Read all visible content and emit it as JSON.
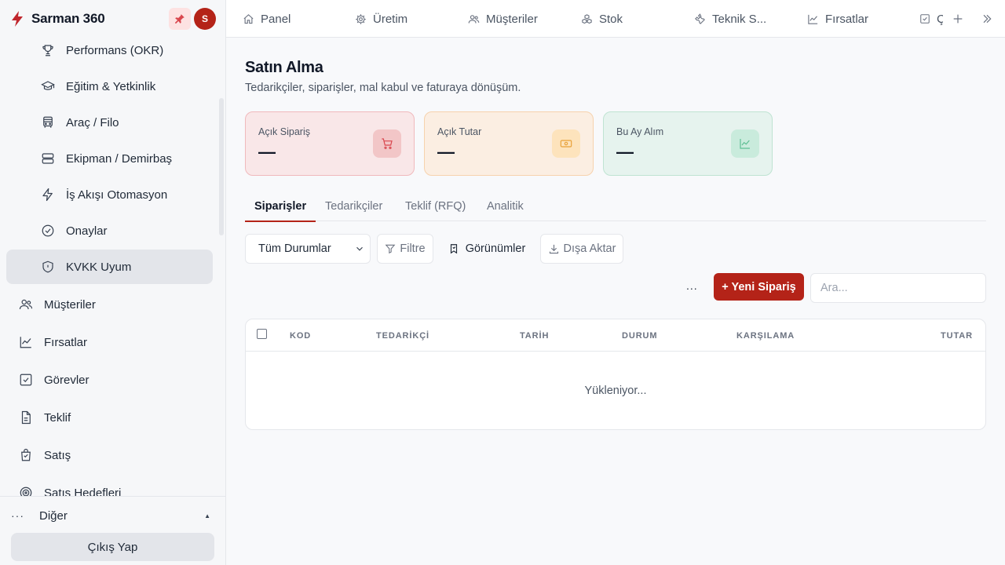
{
  "brand": {
    "name": "Sarman 360",
    "avatar_initial": "S",
    "accent": "#b42318"
  },
  "sidebar": {
    "sub_items": [
      {
        "label": "Performans (OKR)",
        "icon": "trophy-icon"
      },
      {
        "label": "Eğitim & Yetkinlik",
        "icon": "graduation-cap-icon"
      },
      {
        "label": "Araç / Filo",
        "icon": "bus-icon"
      },
      {
        "label": "Ekipman / Demirbaş",
        "icon": "server-icon"
      },
      {
        "label": "İş Akışı Otomasyon",
        "icon": "lightning-icon"
      },
      {
        "label": "Onaylar",
        "icon": "check-circle-icon"
      },
      {
        "label": "KVKK Uyum",
        "icon": "shield-icon",
        "active": true
      }
    ],
    "items": [
      {
        "label": "Müşteriler",
        "icon": "users-icon"
      },
      {
        "label": "Fırsatlar",
        "icon": "trending-chart-icon"
      },
      {
        "label": "Görevler",
        "icon": "checkbox-icon"
      },
      {
        "label": "Teklif",
        "icon": "document-icon"
      },
      {
        "label": "Satış",
        "icon": "shopping-bag-icon"
      },
      {
        "label": "Satış Hedefleri",
        "icon": "target-icon"
      }
    ],
    "other_label": "Diğer",
    "logout_label": "Çıkış Yap"
  },
  "topnav": {
    "tabs": [
      {
        "label": "Panel",
        "icon": "home-icon"
      },
      {
        "label": "Üretim",
        "icon": "gear-icon"
      },
      {
        "label": "Müşteriler",
        "icon": "users-icon"
      },
      {
        "label": "Stok",
        "icon": "boxes-icon"
      },
      {
        "label": "Teknik S...",
        "icon": "wrench-icon"
      },
      {
        "label": "Fırsatlar",
        "icon": "trending-chart-icon"
      },
      {
        "label": "Ç",
        "icon": "checkbox-icon"
      }
    ]
  },
  "page": {
    "title": "Satın Alma",
    "subtitle": "Tedarikçiler, siparişler, mal kabul ve faturaya dönüşüm."
  },
  "kpis": [
    {
      "label": "Açık Sipariş",
      "value": "—",
      "icon": "cart-icon",
      "color": "#d9474e"
    },
    {
      "label": "Açık Tutar",
      "value": "—",
      "icon": "cash-icon",
      "color": "#e8a23a"
    },
    {
      "label": "Bu Ay Alım",
      "value": "—",
      "icon": "trending-chart-icon",
      "color": "#5fbf94"
    }
  ],
  "tabs": [
    {
      "label": "Siparişler",
      "active": true
    },
    {
      "label": "Tedarikçiler"
    },
    {
      "label": "Teklif (RFQ)"
    },
    {
      "label": "Analitik"
    }
  ],
  "toolbar": {
    "status_select": "Tüm Durumlar",
    "filter_label": "Filtre",
    "views_label": "Görünümler",
    "export_label": "Dışa Aktar",
    "more_label": "...",
    "new_label": "+ Yeni Sipariş",
    "search_placeholder": "Ara..."
  },
  "table": {
    "columns": [
      "KOD",
      "TEDARİKÇİ",
      "TARİH",
      "DURUM",
      "KARŞILAMA",
      "TUTAR"
    ],
    "loading_text": "Yükleniyor..."
  }
}
